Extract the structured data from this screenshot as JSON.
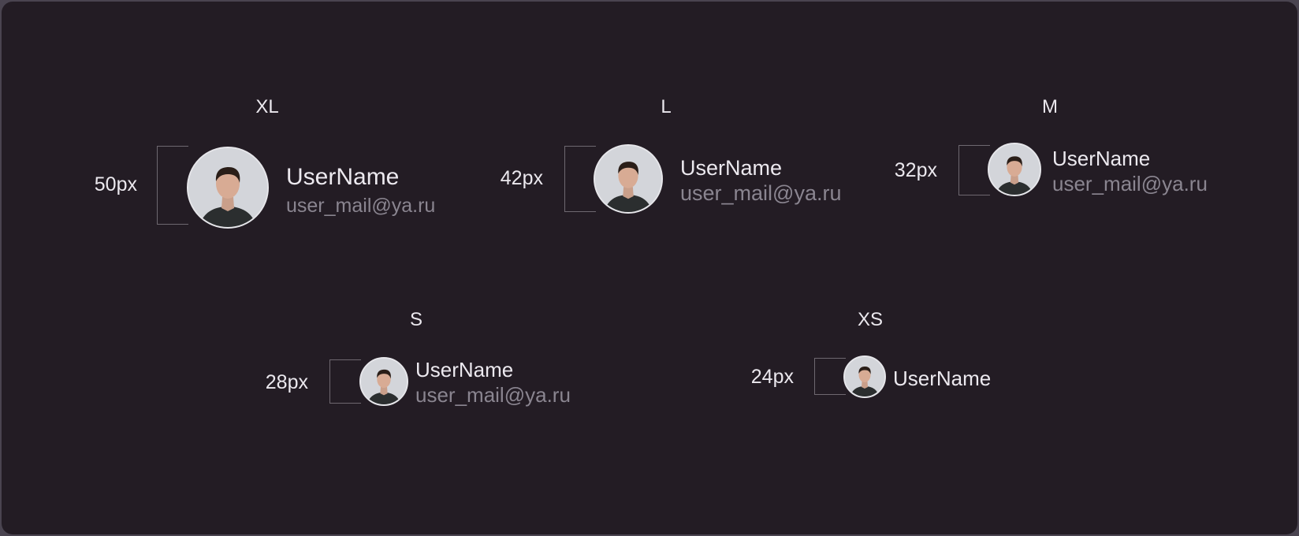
{
  "sizes": [
    {
      "title": "XL",
      "dim": "50px",
      "user": "UserName",
      "email": "user_mail@ya.ru"
    },
    {
      "title": "L",
      "dim": "42px",
      "user": "UserName",
      "email": "user_mail@ya.ru"
    },
    {
      "title": "M",
      "dim": "32px",
      "user": "UserName",
      "email": "user_mail@ya.ru"
    },
    {
      "title": "S",
      "dim": "28px",
      "user": "UserName",
      "email": "user_mail@ya.ru"
    },
    {
      "title": "XS",
      "dim": "24px",
      "user": "UserName"
    }
  ],
  "colors": {
    "background": "#231c24",
    "text": "#ece9ef",
    "muted": "#8a8590",
    "bracket": "#6e6870"
  },
  "icons": {
    "avatar": "person-photo-avatar"
  }
}
